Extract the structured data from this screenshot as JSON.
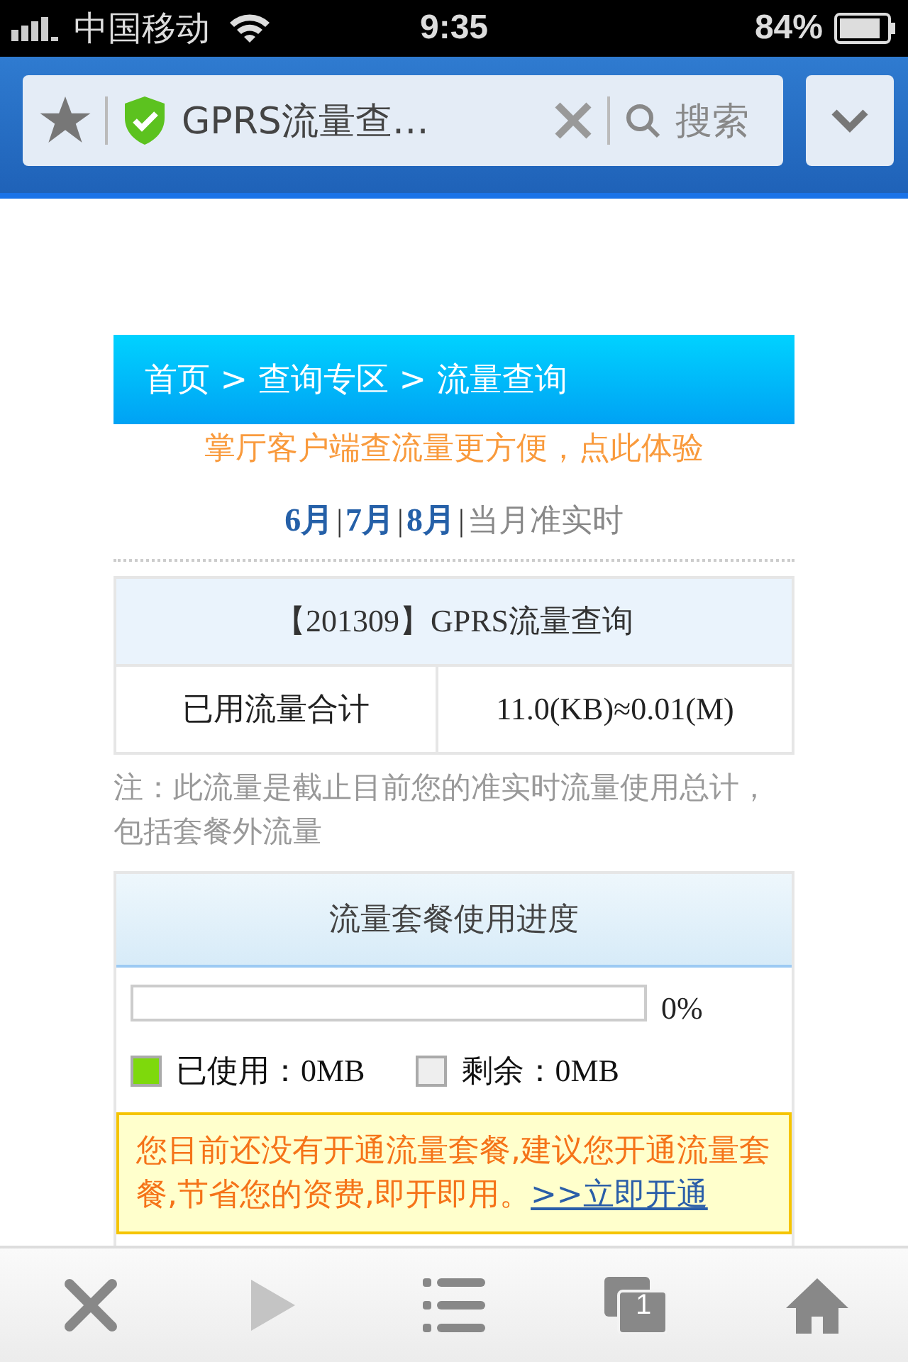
{
  "status_bar": {
    "carrier": "中国移动",
    "time": "9:35",
    "battery": "84%"
  },
  "browser": {
    "page_title": "GPRS流量查…",
    "search_placeholder": "搜索"
  },
  "breadcrumb": "首页 > 查询专区 > 流量查询",
  "promo_link": "掌厅客户端查流量更方便，点此体验",
  "months": [
    {
      "kind": "link",
      "text": "6月"
    },
    {
      "kind": "separator",
      "text": "|"
    },
    {
      "kind": "link",
      "text": "7月"
    },
    {
      "kind": "separator",
      "text": "|"
    },
    {
      "kind": "link",
      "text": "8月"
    },
    {
      "kind": "separator",
      "text": "|"
    },
    {
      "kind": "current",
      "text": "当月准实时"
    }
  ],
  "usage_table": {
    "title": "【201309】GPRS流量查询",
    "rows": [
      {
        "label": "已用流量合计",
        "value": "11.0(KB)≈0.01(M)"
      }
    ]
  },
  "note": "注：此流量是截止目前您的准实时流量使用总计，包括套餐外流量",
  "progress": {
    "title": "流量套餐使用进度",
    "level": 0,
    "percent": "0%",
    "legend": [
      {
        "label": "已使用：0MB",
        "color": "#7ed90c"
      },
      {
        "label": "剩余：0MB",
        "color": "#eeeeee"
      }
    ]
  },
  "notice": {
    "text": "您目前还没有开通流量套餐,建议您开通流量套餐,节省您的资费,即开即用。",
    "link": ">>立即开通"
  },
  "toolbar": {
    "tab_count": "1"
  }
}
